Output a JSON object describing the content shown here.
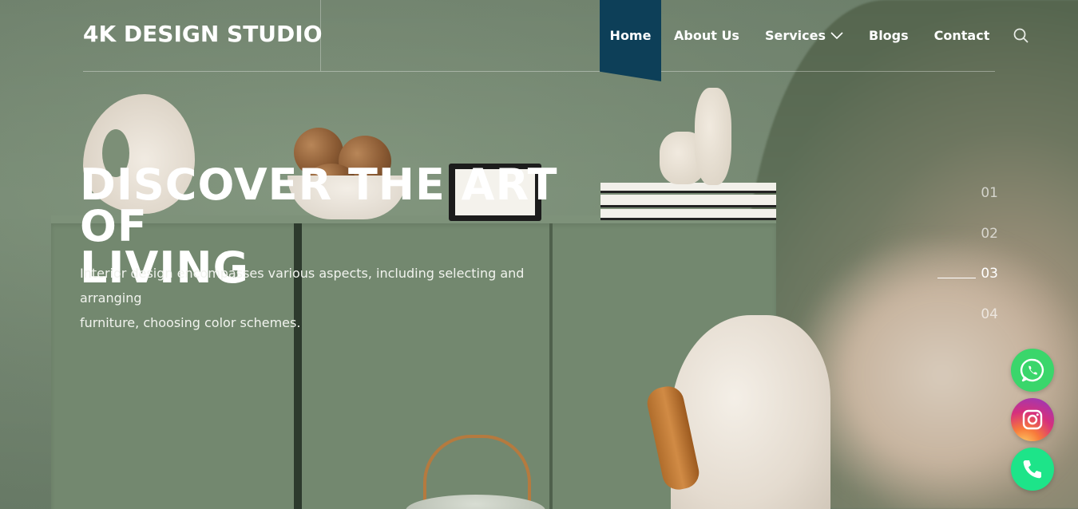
{
  "header": {
    "logo": "4K DESIGN STUDIO",
    "nav": [
      {
        "label": "Home",
        "active": true
      },
      {
        "label": "About Us",
        "active": false
      },
      {
        "label": "Services",
        "active": false,
        "has_dropdown": true
      },
      {
        "label": "Blogs",
        "active": false
      },
      {
        "label": "Contact",
        "active": false
      }
    ],
    "search_icon": "search-icon",
    "active_color": "#0d3f58"
  },
  "hero": {
    "title_line1": "DISCOVER THE ART OF",
    "title_line2": "LIVING",
    "description_line1": "Interior design encompasses various aspects, including selecting and arranging",
    "description_line2": "furniture, choosing color schemes."
  },
  "slider": {
    "items": [
      "01",
      "02",
      "03",
      "04"
    ],
    "active_index": 2
  },
  "social": [
    {
      "name": "whatsapp",
      "icon": "whatsapp-icon",
      "color": "#3ad66b"
    },
    {
      "name": "instagram",
      "icon": "instagram-icon",
      "color": "#d6307c"
    },
    {
      "name": "phone",
      "icon": "phone-icon",
      "color": "#1de489"
    }
  ]
}
